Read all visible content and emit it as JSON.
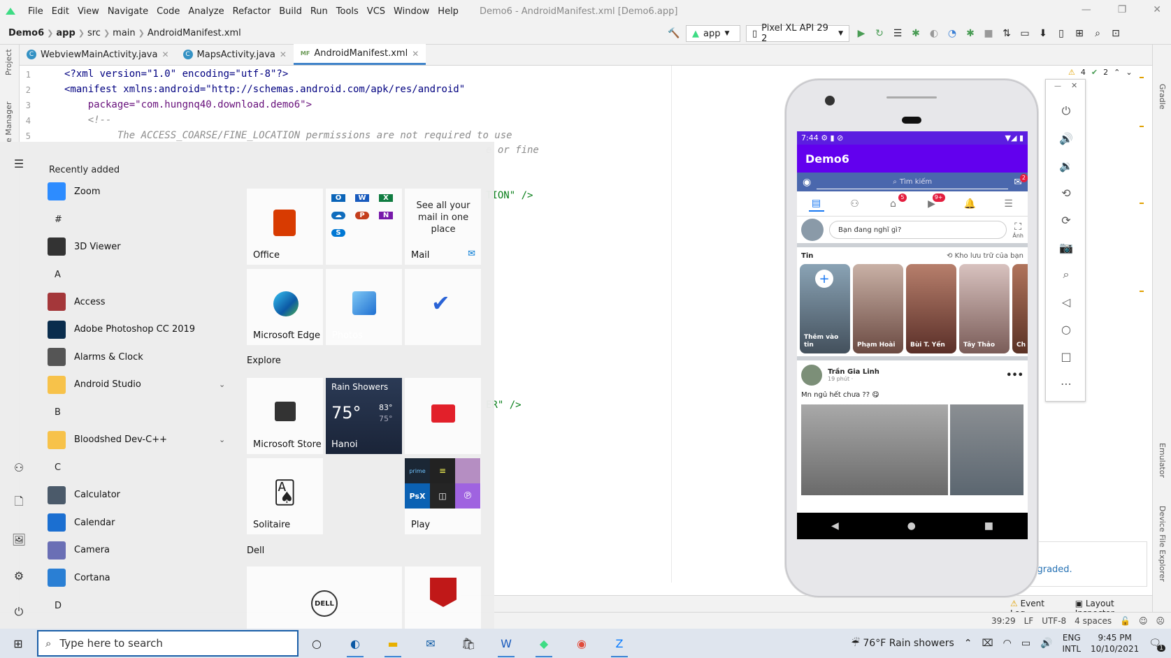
{
  "ide": {
    "menu": [
      "File",
      "Edit",
      "View",
      "Navigate",
      "Code",
      "Analyze",
      "Refactor",
      "Build",
      "Run",
      "Tools",
      "VCS",
      "Window",
      "Help"
    ],
    "window_title": "Demo6 - AndroidManifest.xml [Demo6.app]",
    "breadcrumb": [
      "Demo6",
      "app",
      "src",
      "main",
      "AndroidManifest.xml"
    ],
    "run_config": "app",
    "device": "Pixel XL API 29 2",
    "tabs": [
      {
        "label": "WebviewMainActivity.java",
        "type": "java"
      },
      {
        "label": "MapsActivity.java",
        "type": "java"
      },
      {
        "label": "AndroidManifest.xml",
        "type": "xml",
        "active": true
      }
    ],
    "left_tools": [
      "Project",
      "e Manager"
    ],
    "right_tools": [
      "Gradle",
      "Emulator",
      "Device File Explorer"
    ],
    "inspections": {
      "warnings": "4",
      "checks": "2"
    },
    "code_lines": [
      {
        "n": "1",
        "text": "<?xml version=\"1.0\" encoding=\"utf-8\"?>"
      },
      {
        "n": "2",
        "text": "<manifest xmlns:android=\"http://schemas.android.com/apk/res/android\""
      },
      {
        "n": "3",
        "text": "    package=\"com.hungnq40.download.demo6\">"
      },
      {
        "n": "4",
        "text": "    <!--"
      },
      {
        "n": "5",
        "text": "         The ACCESS_COARSE/FINE_LOCATION permissions are not required to use"
      }
    ],
    "code_fragments": [
      "e or fine",
      "TION\" />",
      "ER\" />"
    ],
    "notification_fragment": "upgraded.",
    "bottom_tools": {
      "event_log": "Event Log",
      "layout_inspector": "Layout Inspector"
    },
    "status": {
      "pos": "39:29",
      "line_sep": "LF",
      "encoding": "UTF-8",
      "indent": "4 spaces"
    }
  },
  "start_menu": {
    "recently_added": "Recently added",
    "apps": [
      {
        "kind": "app",
        "label": "Zoom",
        "icon": "zoom-icon",
        "color": "#2d8cff"
      },
      {
        "kind": "letter",
        "label": "#"
      },
      {
        "kind": "app",
        "label": "3D Viewer",
        "icon": "cube-icon",
        "color": "#333333"
      },
      {
        "kind": "letter",
        "label": "A"
      },
      {
        "kind": "app",
        "label": "Access",
        "icon": "access-icon",
        "color": "#a4373a"
      },
      {
        "kind": "app",
        "label": "Adobe Photoshop CC 2019",
        "icon": "photoshop-icon",
        "color": "#0a2d4d"
      },
      {
        "kind": "app",
        "label": "Alarms & Clock",
        "icon": "clock-icon",
        "color": "#555555"
      },
      {
        "kind": "folder",
        "label": "Android Studio",
        "icon": "folder-icon",
        "color": "#f7c24a"
      },
      {
        "kind": "letter",
        "label": "B"
      },
      {
        "kind": "folder",
        "label": "Bloodshed Dev-C++",
        "icon": "folder-icon",
        "color": "#f7c24a"
      },
      {
        "kind": "letter",
        "label": "C"
      },
      {
        "kind": "app",
        "label": "Calculator",
        "icon": "calculator-icon",
        "color": "#4b5a6a"
      },
      {
        "kind": "app",
        "label": "Calendar",
        "icon": "calendar-icon",
        "color": "#1b6fd1"
      },
      {
        "kind": "app",
        "label": "Camera",
        "icon": "camera-icon",
        "color": "#6a6fb5"
      },
      {
        "kind": "app",
        "label": "Cortana",
        "icon": "cortana-icon",
        "color": "#2a7fd4"
      },
      {
        "kind": "letter",
        "label": "D"
      }
    ],
    "groups": {
      "explore": "Explore",
      "dell": "Dell"
    },
    "tiles": {
      "office": "Office",
      "mail_text": "See all your mail in one place",
      "mail": "Mail",
      "edge": "Microsoft Edge",
      "photos": "Photos",
      "store": "Microsoft Store",
      "weather": {
        "title": "Rain Showers",
        "temp": "75°",
        "hi": "83°",
        "lo": "75°",
        "city": "Hanoi"
      },
      "solitaire": "Solitaire",
      "play": "Play"
    }
  },
  "phone": {
    "time": "7:44",
    "app_title": "Demo6",
    "search_placeholder": "Tìm kiếm",
    "messenger_badge": "2",
    "nav_badges": {
      "market": "5",
      "video": "9+"
    },
    "composer_placeholder": "Bạn đang nghĩ gì?",
    "photo_label": "Ảnh",
    "stories_title": "Tin",
    "archive": "Kho lưu trữ của bạn",
    "stories": [
      {
        "name": "Thêm vào tin"
      },
      {
        "name": "Phạm Hoài"
      },
      {
        "name": "Bùi T. Yến"
      },
      {
        "name": "Tây Thảo"
      },
      {
        "name": "Ch Th"
      }
    ],
    "post": {
      "author": "Trần Gia Linh",
      "time": "19 phút · ",
      "text": "Mn ngủ hết chưa ?? 😋"
    }
  },
  "taskbar": {
    "search_placeholder": "Type here to search",
    "weather": "76°F  Rain showers",
    "lang": "ENG",
    "lang2": "INTL",
    "time": "9:45 PM",
    "date": "10/10/2021",
    "notif_count": "1"
  }
}
